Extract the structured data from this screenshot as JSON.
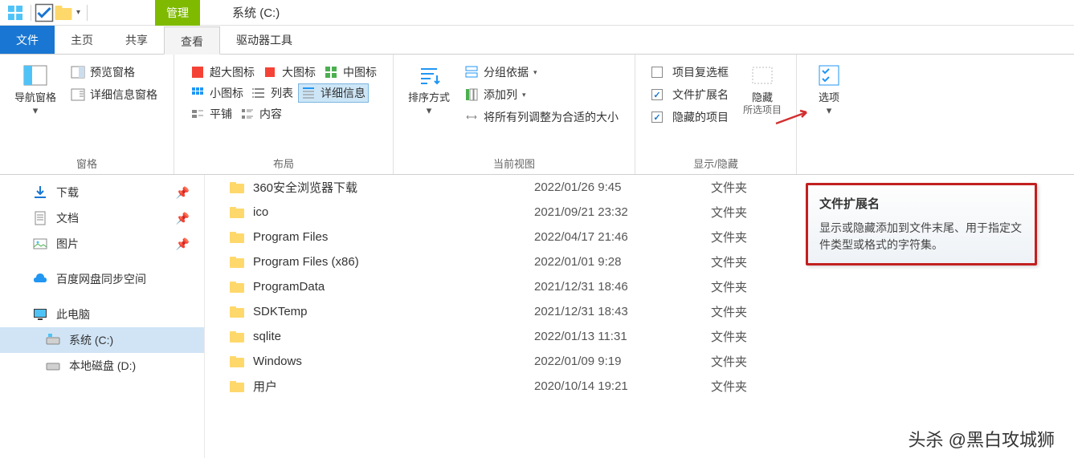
{
  "title": "系统 (C:)",
  "title_tab_manage": "管理",
  "tabs": {
    "file": "文件",
    "home": "主页",
    "share": "共享",
    "view": "查看",
    "tools": "驱动器工具"
  },
  "ribbon": {
    "panes_group": "窗格",
    "nav_pane": "导航窗格",
    "preview_pane": "预览窗格",
    "details_pane": "详细信息窗格",
    "layout_group": "布局",
    "layout": {
      "extra_large": "超大图标",
      "large": "大图标",
      "medium": "中图标",
      "small": "小图标",
      "list": "列表",
      "details": "详细信息",
      "tiles": "平铺",
      "content": "内容"
    },
    "current_view_group": "当前视图",
    "sort_by": "排序方式",
    "group_by": "分组依据",
    "add_columns": "添加列",
    "size_all": "将所有列调整为合适的大小",
    "show_hide_group": "显示/隐藏",
    "item_checkboxes": "项目复选框",
    "file_ext": "文件扩展名",
    "hidden_items": "隐藏的项目",
    "hide": "隐藏",
    "hide_sub": "所选项目",
    "options": "选项"
  },
  "nav": {
    "downloads": "下载",
    "documents": "文档",
    "pictures": "图片",
    "baidu": "百度网盘同步空间",
    "this_pc": "此电脑",
    "c_drive": "系统 (C:)",
    "d_drive": "本地磁盘 (D:)"
  },
  "files": [
    {
      "name": "360安全浏览器下载",
      "date": "2022/01/26 9:45",
      "type": "文件夹"
    },
    {
      "name": "ico",
      "date": "2021/09/21 23:32",
      "type": "文件夹"
    },
    {
      "name": "Program Files",
      "date": "2022/04/17 21:46",
      "type": "文件夹"
    },
    {
      "name": "Program Files (x86)",
      "date": "2022/01/01 9:28",
      "type": "文件夹"
    },
    {
      "name": "ProgramData",
      "date": "2021/12/31 18:46",
      "type": "文件夹"
    },
    {
      "name": "SDKTemp",
      "date": "2021/12/31 18:43",
      "type": "文件夹"
    },
    {
      "name": "sqlite",
      "date": "2022/01/13 11:31",
      "type": "文件夹"
    },
    {
      "name": "Windows",
      "date": "2022/01/09 9:19",
      "type": "文件夹"
    },
    {
      "name": "用户",
      "date": "2020/10/14 19:21",
      "type": "文件夹"
    }
  ],
  "tooltip": {
    "title": "文件扩展名",
    "body": "显示或隐藏添加到文件末尾、用于指定文件类型或格式的字符集。"
  },
  "watermark": "头杀 @黑白攻城狮"
}
